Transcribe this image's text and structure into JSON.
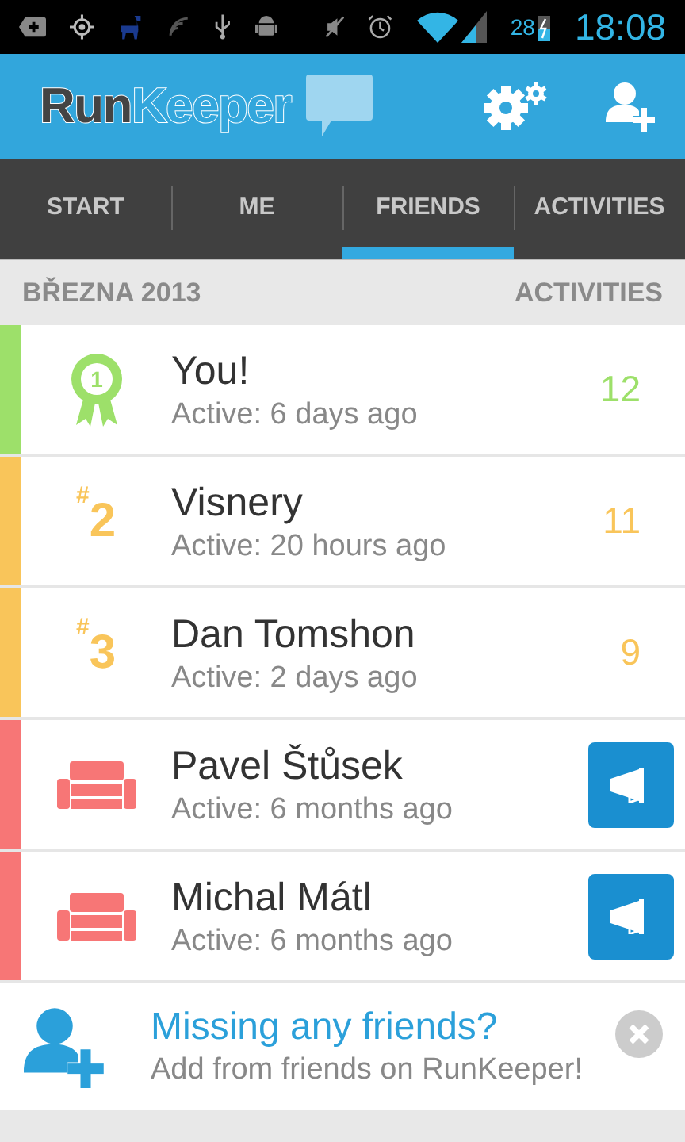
{
  "status_bar": {
    "battery": "28",
    "time": "18:08"
  },
  "header": {
    "logo_part_1": "Run",
    "logo_part_2": "Keeper"
  },
  "tabs": [
    {
      "label": "START",
      "selected": false
    },
    {
      "label": "ME",
      "selected": false
    },
    {
      "label": "FRIENDS",
      "selected": true
    },
    {
      "label": "ACTIVITIES",
      "selected": false
    }
  ],
  "section": {
    "title": "BŘEZNA 2013",
    "column": "ACTIVITIES"
  },
  "friends": [
    {
      "kind": "leader",
      "color": "#9de06a",
      "rank": "1",
      "name": "You!",
      "activity": "Active: 6 days ago",
      "count": "12"
    },
    {
      "kind": "ranked",
      "color": "#f9c55a",
      "rank": "$^{#}$2",
      "name": "Visnery",
      "activity": "Active: 20 hours ago",
      "count": "11"
    },
    {
      "kind": "ranked",
      "color": "#f9c55a",
      "rank": "$^{#}$3",
      "name": "Dan Tomshon",
      "activity": "Active: 2 days ago",
      "count": "9"
    },
    {
      "kind": "inactive",
      "color": "#f77676",
      "name": "Pavel Štůsek",
      "activity": "Active: 6 months ago"
    },
    {
      "kind": "inactive",
      "color": "#f77676",
      "name": "Michal Mátl",
      "activity": "Active: 6 months ago"
    }
  ],
  "promo": {
    "title": "Missing any friends?",
    "text": "Add from friends on RunKeeper!"
  }
}
